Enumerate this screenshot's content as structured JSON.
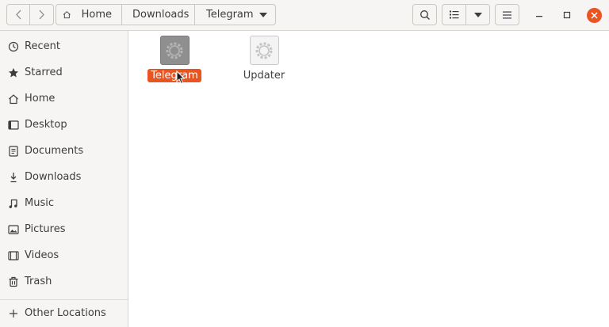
{
  "headerbar": {
    "back_icon": "chevron-left-icon",
    "forward_icon": "chevron-right-icon",
    "path": [
      "Home",
      "Downloads",
      "Telegram"
    ],
    "search_icon": "search-icon",
    "view_icon": "list-view-icon",
    "view_dropdown_icon": "caret-down-icon",
    "menu_icon": "hamburger-menu-icon",
    "window_controls": [
      "minimize-icon",
      "maximize-icon",
      "close-icon"
    ],
    "close_color": "#e95420"
  },
  "sidebar": {
    "items": [
      {
        "label": "Recent",
        "icon": "clock-icon"
      },
      {
        "label": "Starred",
        "icon": "star-icon"
      },
      {
        "label": "Home",
        "icon": "home-icon"
      },
      {
        "label": "Desktop",
        "icon": "desktop-icon"
      },
      {
        "label": "Documents",
        "icon": "document-icon"
      },
      {
        "label": "Downloads",
        "icon": "download-icon"
      },
      {
        "label": "Music",
        "icon": "music-icon"
      },
      {
        "label": "Pictures",
        "icon": "picture-icon"
      },
      {
        "label": "Videos",
        "icon": "video-icon"
      },
      {
        "label": "Trash",
        "icon": "trash-icon"
      }
    ],
    "other_locations": {
      "label": "Other Locations",
      "icon": "plus-icon"
    }
  },
  "files": [
    {
      "name": "Telegram",
      "icon": "executable-gear-icon",
      "selected": true
    },
    {
      "name": "Updater",
      "icon": "executable-gear-icon",
      "selected": false
    }
  ],
  "accent_color": "#e95420"
}
